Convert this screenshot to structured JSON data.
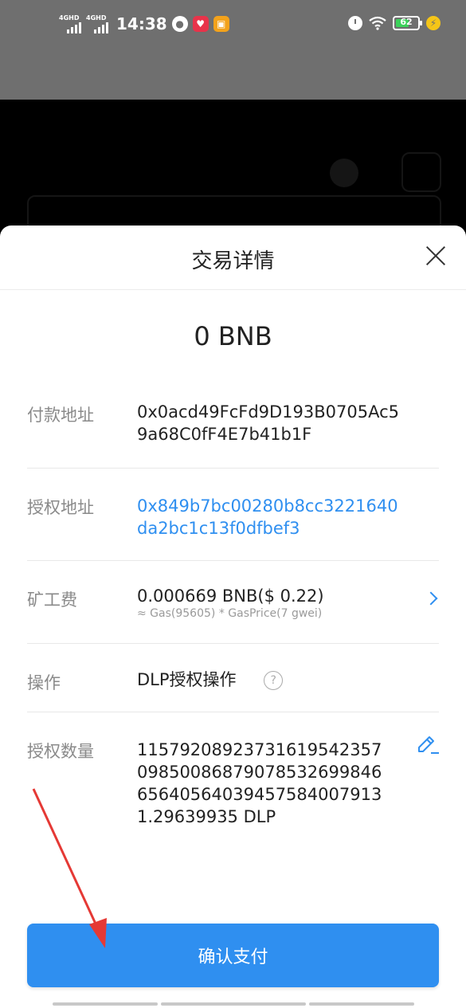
{
  "status_bar": {
    "signal1_label": "4GHD",
    "signal2_label": "4GHD",
    "time": "14:38",
    "battery": "62",
    "battery_percent": 62
  },
  "sheet": {
    "title": "交易详情",
    "amount": "0 BNB",
    "rows": [
      {
        "label": "付款地址",
        "value": "0x0acd49FcFd9D193B0705Ac59a68C0fF4E7b41b1F"
      },
      {
        "label": "授权地址",
        "value": "0x849b7bc00280b8cc3221640da2bc1c13f0dfbef3"
      },
      {
        "label": "矿工费",
        "value": "0.000669 BNB($ 0.22)",
        "sub": "≈ Gas(95605) * GasPrice(7 gwei)"
      },
      {
        "label": "操作",
        "value": "DLP授权操作"
      },
      {
        "label": "授权数量",
        "value": "1157920892373161954235709850086879078532699846656405640394575840079131.29639935 DLP"
      }
    ],
    "confirm_label": "确认支付"
  },
  "colors": {
    "accent": "#2f8ff0",
    "label": "#8a8a8a",
    "text": "#222222"
  }
}
